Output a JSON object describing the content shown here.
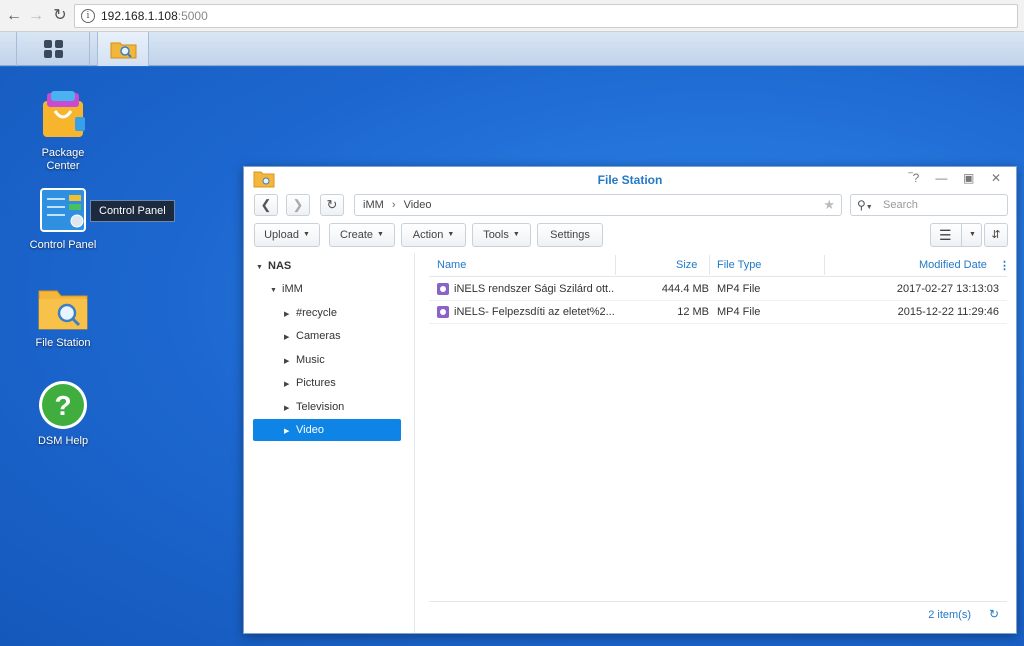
{
  "browser": {
    "url_host": "192.168.1.108",
    "url_port": ":5000"
  },
  "desktop": {
    "icons": [
      {
        "label": "Package\nCenter",
        "line1": "Package",
        "line2": "Center"
      },
      {
        "label": "Control Panel"
      },
      {
        "label": "File Station"
      },
      {
        "label": "DSM Help"
      }
    ],
    "tooltip": "Control Panel"
  },
  "window": {
    "title": "File Station",
    "path": [
      "iMM",
      "Video"
    ],
    "search_placeholder": "Search",
    "actions": [
      "Upload",
      "Create",
      "Action",
      "Tools",
      "Settings"
    ],
    "tree": {
      "root": "NAS",
      "share": "iMM",
      "folders": [
        "#recycle",
        "Cameras",
        "Music",
        "Pictures",
        "Television",
        "Video"
      ],
      "selected": "Video"
    },
    "columns": {
      "name": "Name",
      "size": "Size",
      "type": "File Type",
      "modified": "Modified Date"
    },
    "files": [
      {
        "name": "iNELS rendszer Sági Szilárd ott...",
        "size": "444.4 MB",
        "type": "MP4 File",
        "modified": "2017-02-27 13:13:03"
      },
      {
        "name": "iNELS- Felpezsdíti az eletet%2...",
        "size": "12 MB",
        "type": "MP4 File",
        "modified": "2015-12-22 11:29:46"
      }
    ],
    "item_count": "2 item(s)"
  },
  "colors": {
    "accent": "#2279c7",
    "selection": "#0e85e6",
    "desktop": "#1f6fd6"
  }
}
